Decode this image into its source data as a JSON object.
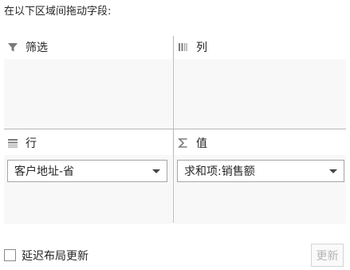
{
  "instruction": "在以下区域间拖动字段:",
  "areas": {
    "filters": {
      "label": "筛选",
      "icon": "filter-icon",
      "fields": []
    },
    "columns": {
      "label": "列",
      "icon": "columns-icon",
      "fields": []
    },
    "rows": {
      "label": "行",
      "icon": "rows-icon",
      "fields": [
        {
          "label": "客户地址-省"
        }
      ]
    },
    "values": {
      "label": "值",
      "icon": "sigma-icon",
      "fields": [
        {
          "label": "求和项:销售额"
        }
      ]
    }
  },
  "footer": {
    "defer_label": "延迟布局更新",
    "defer_checked": false,
    "update_label": "更新",
    "update_enabled": false
  },
  "colors": {
    "icon": "#7a7a7a",
    "divider": "#b8b8b8",
    "area_bg": "#f8f8f8"
  }
}
